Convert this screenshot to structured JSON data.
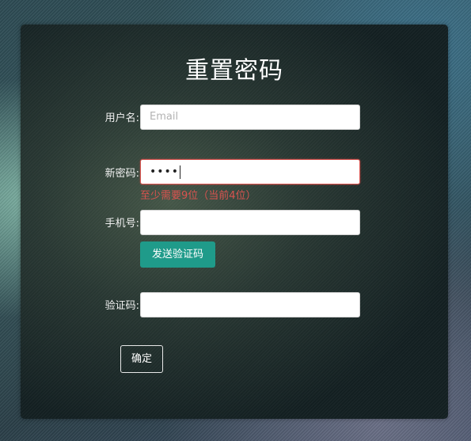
{
  "form": {
    "title": "重置密码",
    "username": {
      "label": "用户名:",
      "placeholder": "Email",
      "value": ""
    },
    "new_password": {
      "label": "新密码:",
      "masked_value": "••••",
      "error": "至少需要9位（当前4位）"
    },
    "phone": {
      "label": "手机号:",
      "value": ""
    },
    "send_code_button": "发送验证码",
    "code": {
      "label": "验证码:",
      "value": ""
    },
    "confirm_button": "确定"
  },
  "colors": {
    "accent": "#1f9b8a",
    "error": "#d9534f",
    "panel": "#1b2a2b"
  }
}
